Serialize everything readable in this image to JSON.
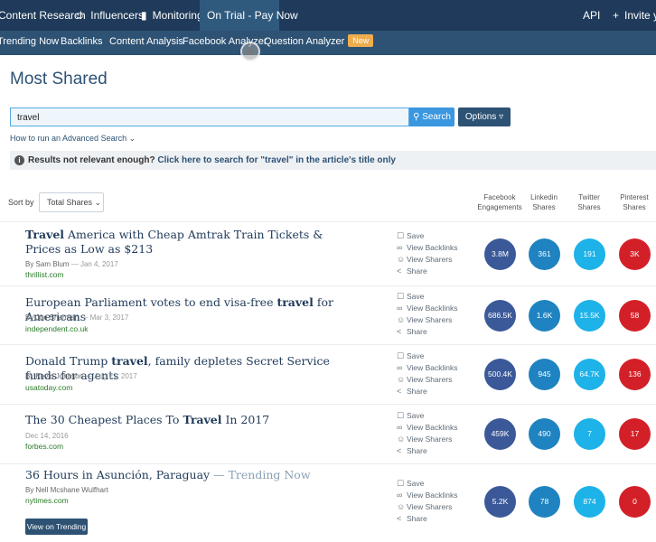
{
  "topbar": {
    "content_research": "Content Research",
    "influencers": "Influencers",
    "monitoring": "Monitoring",
    "on_trial": "On Trial - Pay Now",
    "api": "API",
    "invite": "Invite yo"
  },
  "subnav": {
    "items": [
      "Trending Now",
      "Backlinks",
      "Content Analysis",
      "Facebook Analyzer",
      "Question Analyzer"
    ],
    "new_badge": "New"
  },
  "page_title": "Most Shared",
  "search": {
    "value": "travel",
    "button": "Search",
    "options": "Options"
  },
  "advanced_link": "How to run an Advanced Search",
  "info": {
    "prefix": "Results not relevant enough?",
    "link": "Click here to search for \"travel\" in the article's title only"
  },
  "sort": {
    "label": "Sort by",
    "value": "Total Shares"
  },
  "columns": [
    [
      "Facebook",
      "Engagements"
    ],
    [
      "Linkedin",
      "Shares"
    ],
    [
      "Twitter",
      "Shares"
    ],
    [
      "Pinterest",
      "Shares"
    ]
  ],
  "actions": {
    "save": "Save",
    "backlinks": "View Backlinks",
    "sharers": "View Sharers",
    "share": "Share"
  },
  "colors": {
    "facebook": "#3b5998",
    "linkedin": "#1e83c0",
    "twitter": "#1db2e8",
    "pinterest": "#d32028",
    "nav": "#1f3a5a"
  },
  "articles": [
    {
      "title_before": "",
      "title_bold": "Travel",
      "title_after": " America with Cheap Amtrak Train Tickets & Prices as Low as $213",
      "trend": "",
      "by": "By Sam Blum",
      "date": "Jan 4, 2017",
      "domain": "thrillist.com",
      "facebook": "3.8M",
      "linkedin": "361",
      "twitter": "191",
      "pinterest": "3K"
    },
    {
      "title_before": "European Parliament votes to end visa-free ",
      "title_bold": "travel",
      "title_after": " for Americans",
      "trend": "",
      "by": "By Jon Sharman",
      "date": "Mar 3, 2017",
      "domain": "independent.co.uk",
      "facebook": "686.5K",
      "linkedin": "1.6K",
      "twitter": "15.5K",
      "pinterest": "58"
    },
    {
      "title_before": "Donald Trump ",
      "title_bold": "travel",
      "title_after": ", family depletes Secret Service funds for agents",
      "trend": "",
      "by": "By Kevin Johnson",
      "date": "Aug 21, 2017",
      "domain": "usatoday.com",
      "facebook": "500.4K",
      "linkedin": "945",
      "twitter": "64.7K",
      "pinterest": "136"
    },
    {
      "title_before": "The 30 Cheapest Places To ",
      "title_bold": "Travel",
      "title_after": " In 2017",
      "trend": "",
      "by": "",
      "date": "Dec 14, 2016",
      "domain": "forbes.com",
      "facebook": "459K",
      "linkedin": "490",
      "twitter": "7",
      "pinterest": "17"
    },
    {
      "title_before": "36 Hours in Asunción, Paraguay",
      "title_bold": "",
      "title_after": "",
      "trend": "— Trending Now",
      "by": "By Nell Mcshane Wulfhart",
      "date": "",
      "domain": "nytimes.com",
      "facebook": "5.2K",
      "linkedin": "78",
      "twitter": "874",
      "pinterest": "0",
      "trending_button": "View on Trending"
    }
  ]
}
